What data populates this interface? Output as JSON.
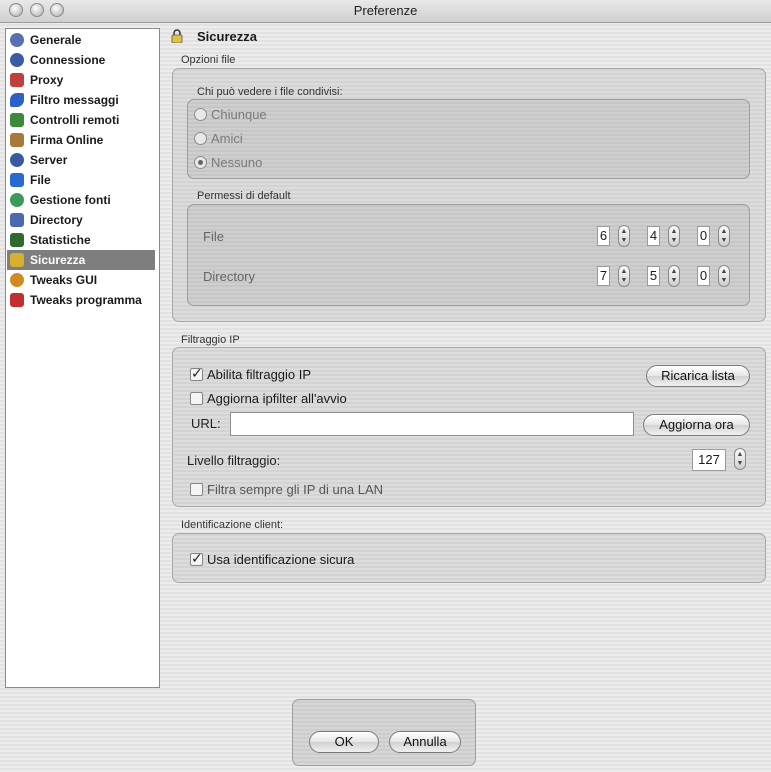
{
  "window": {
    "title": "Preferenze"
  },
  "sidebar": {
    "items": [
      {
        "label": "Generale",
        "icon": "gear-icon",
        "color": "#5a6fb0"
      },
      {
        "label": "Connessione",
        "icon": "network-icon",
        "color": "#3b5aa8"
      },
      {
        "label": "Proxy",
        "icon": "proxy-icon",
        "color": "#c04040"
      },
      {
        "label": "Filtro messaggi",
        "icon": "filter-icon",
        "color": "#2c62c7"
      },
      {
        "label": "Controlli remoti",
        "icon": "remote-icon",
        "color": "#3a8a3a"
      },
      {
        "label": "Firma Online",
        "icon": "sign-icon",
        "color": "#a87a3a"
      },
      {
        "label": "Server",
        "icon": "server-icon",
        "color": "#3a5aa0"
      },
      {
        "label": "File",
        "icon": "file-icon",
        "color": "#2a6ad0"
      },
      {
        "label": "Gestione fonti",
        "icon": "sources-icon",
        "color": "#3a9a5a"
      },
      {
        "label": "Directory",
        "icon": "directory-icon",
        "color": "#4a6ab0"
      },
      {
        "label": "Statistiche",
        "icon": "stats-icon",
        "color": "#2f6a2f"
      },
      {
        "label": "Sicurezza",
        "icon": "lock-icon",
        "color": "#d8b030",
        "selected": true
      },
      {
        "label": "Tweaks GUI",
        "icon": "gui-icon",
        "color": "#d08a20"
      },
      {
        "label": "Tweaks programma",
        "icon": "tools-icon",
        "color": "#c03030"
      }
    ]
  },
  "section": {
    "title": "Sicurezza"
  },
  "opzioni_file": {
    "label": "Opzioni file",
    "visibility": {
      "label": "Chi può vedere i file condivisi:",
      "options": [
        "Chiunque",
        "Amici",
        "Nessuno"
      ],
      "selected": "Nessuno"
    },
    "permissions": {
      "label": "Permessi di default",
      "rows": [
        {
          "label": "File",
          "values": [
            "6",
            "4",
            "0"
          ]
        },
        {
          "label": "Directory",
          "values": [
            "7",
            "5",
            "0"
          ]
        }
      ]
    }
  },
  "filtraggio": {
    "label": "Filtraggio IP",
    "enable_label": "Abilita filtraggio IP",
    "enable_checked": true,
    "reload_label": "Ricarica lista",
    "update_on_start_label": "Aggiorna ipfilter all'avvio",
    "update_on_start_checked": false,
    "url_label": "URL:",
    "url_value": "",
    "update_now_label": "Aggiorna ora",
    "level_label": "Livello filtraggio:",
    "level_value": "127",
    "lan_label": "Filtra sempre gli IP di una LAN",
    "lan_checked": false
  },
  "identificazione": {
    "label": "Identificazione client:",
    "secure_label": "Usa identificazione sicura",
    "secure_checked": true
  },
  "footer": {
    "ok_label": "OK",
    "cancel_label": "Annulla"
  }
}
